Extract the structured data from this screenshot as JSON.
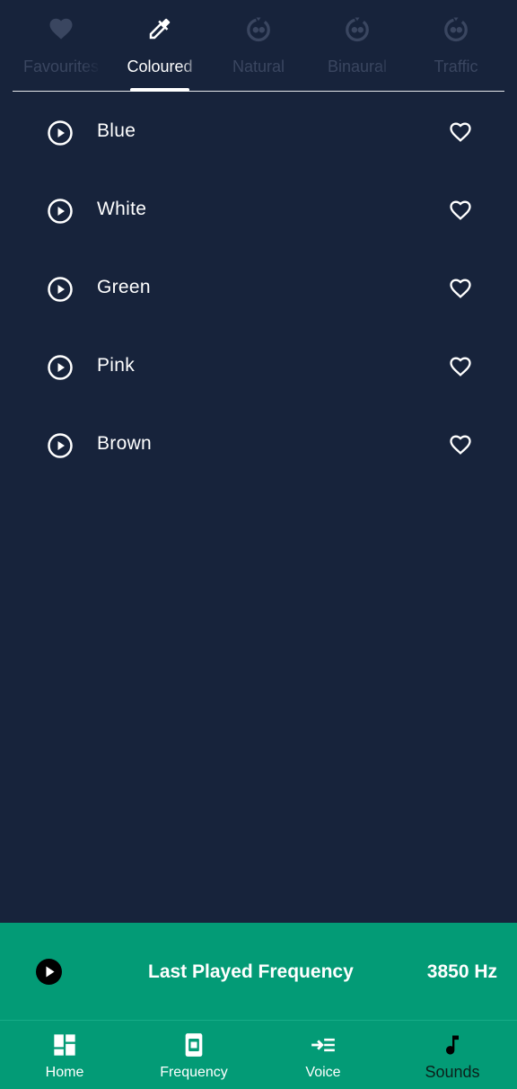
{
  "tabs": [
    {
      "label": "Favourites",
      "icon": "heart-icon",
      "active": false
    },
    {
      "label": "Coloured",
      "icon": "eyedropper-icon",
      "active": true
    },
    {
      "label": "Natural",
      "icon": "sound-waves-icon",
      "active": false
    },
    {
      "label": "Binaural",
      "icon": "sound-waves-icon",
      "active": false
    },
    {
      "label": "Traffic",
      "icon": "sound-waves-icon",
      "active": false
    }
  ],
  "sounds": [
    {
      "label": "Blue"
    },
    {
      "label": "White"
    },
    {
      "label": "Green"
    },
    {
      "label": "Pink"
    },
    {
      "label": "Brown"
    }
  ],
  "now_playing": {
    "title": "Last Played Frequency",
    "value": "3850 Hz"
  },
  "bottom_nav": [
    {
      "label": "Home",
      "icon": "dashboard-icon"
    },
    {
      "label": "Frequency",
      "icon": "frequency-device-icon"
    },
    {
      "label": "Voice",
      "icon": "voice-list-icon"
    },
    {
      "label": "Sounds",
      "icon": "music-note-icon",
      "active": true
    }
  ],
  "colors": {
    "background": "#17233b",
    "accent": "#039b76",
    "inactive_tab": "#3a4660"
  }
}
